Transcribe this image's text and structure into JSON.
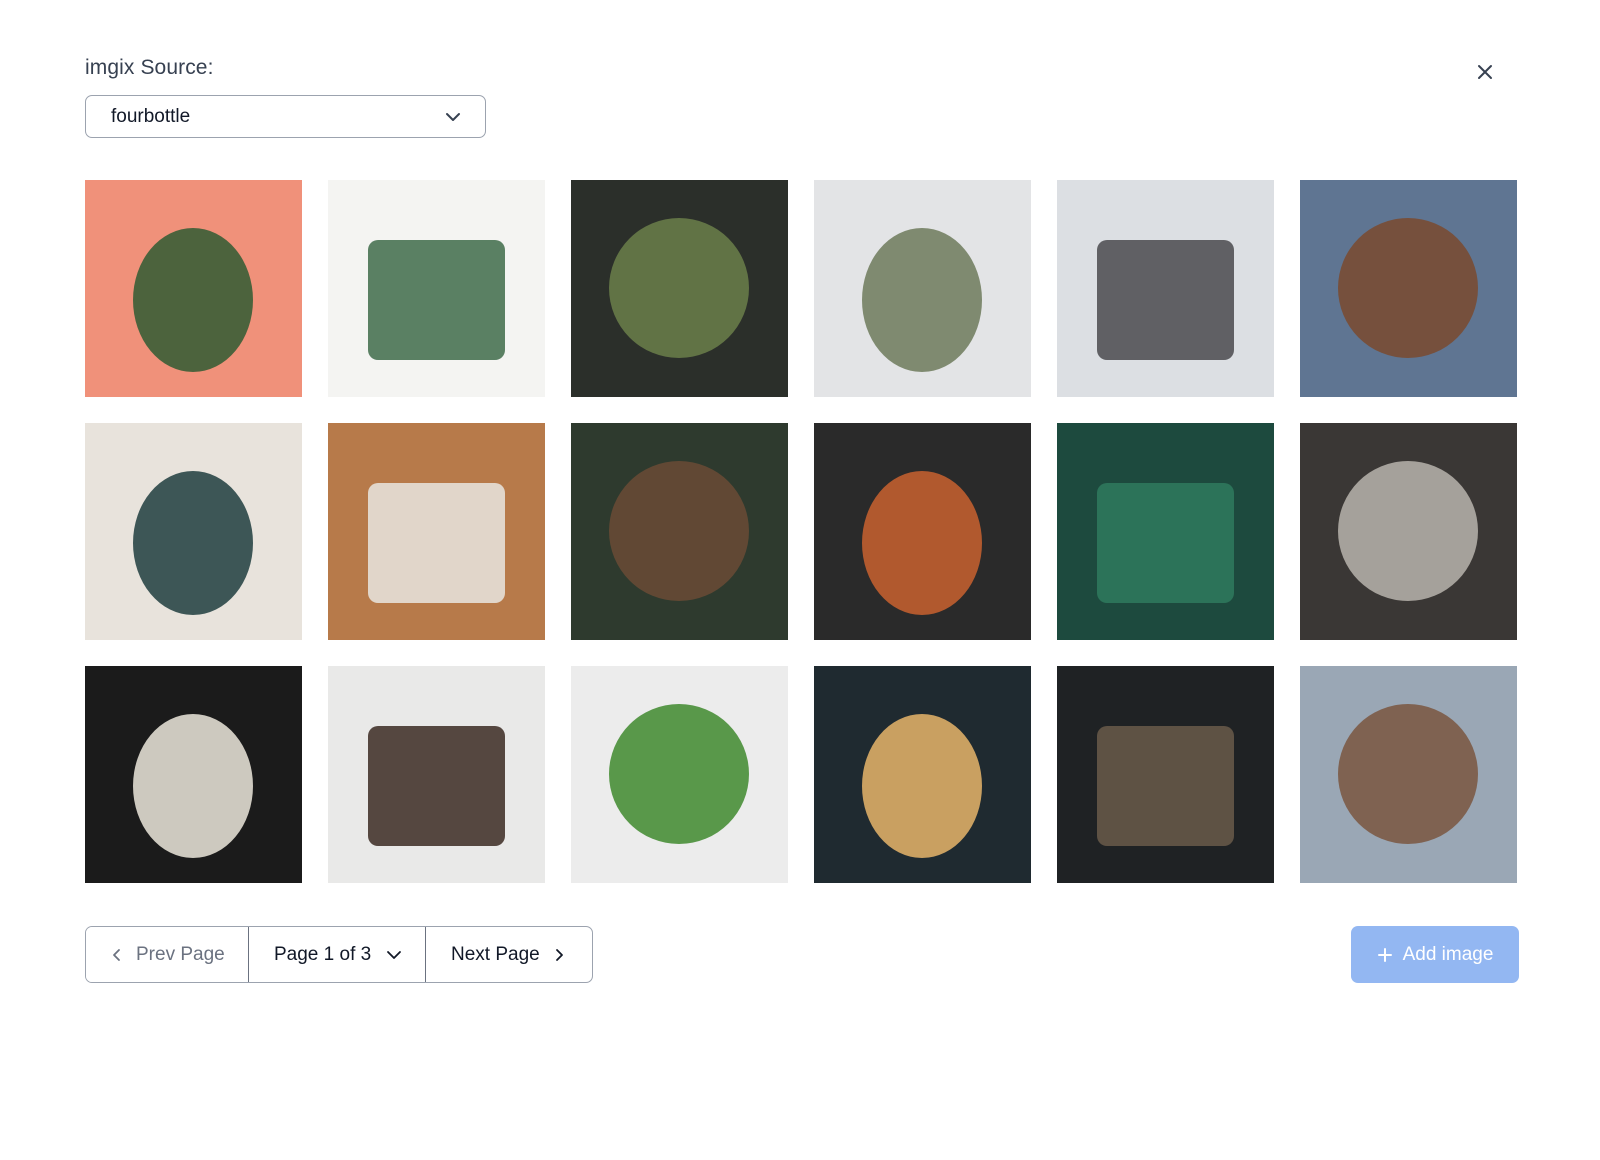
{
  "source": {
    "label": "imgix Source:",
    "selected": "fourbottle",
    "chevron_icon": "chevron-down-icon"
  },
  "close_icon": "close-icon",
  "images": [
    {
      "name": "image-pink-succulent",
      "bg": "#f0917a",
      "fg": "#2f5a32"
    },
    {
      "name": "image-aloe-pot",
      "bg": "#f4f4f2",
      "fg": "#3e6b4a"
    },
    {
      "name": "image-cafe-window-woman",
      "bg": "#2b2f2a",
      "fg": "#6b7f4a"
    },
    {
      "name": "image-plant-shelves",
      "bg": "#e3e4e6",
      "fg": "#6d7a5a"
    },
    {
      "name": "image-woman-coffee",
      "bg": "#dcdfe3",
      "fg": "#4a4a4e"
    },
    {
      "name": "image-pour-over",
      "bg": "#5f7592",
      "fg": "#7a4a2e"
    },
    {
      "name": "image-record-player",
      "bg": "#e8e3dc",
      "fg": "#1f3d3e"
    },
    {
      "name": "image-coffee-shelves",
      "bg": "#b77a4a",
      "fg": "#e9e6e1"
    },
    {
      "name": "image-clay-teapot",
      "bg": "#2e3a2e",
      "fg": "#6a4b35"
    },
    {
      "name": "image-office-cafe",
      "bg": "#2a2a2a",
      "fg": "#c9622f"
    },
    {
      "name": "image-striped-leaves",
      "bg": "#1d4a3e",
      "fg": "#2f7a5e"
    },
    {
      "name": "image-man-reading",
      "bg": "#3a3735",
      "fg": "#b9b4ad"
    },
    {
      "name": "image-chalk-menu",
      "bg": "#1b1b1b",
      "fg": "#ece8dc"
    },
    {
      "name": "image-glass-cup",
      "bg": "#e9e9e8",
      "fg": "#3b2a22"
    },
    {
      "name": "image-potted-plant",
      "bg": "#ececec",
      "fg": "#3f8a2e"
    },
    {
      "name": "image-pendant-lights",
      "bg": "#1f2a30",
      "fg": "#e8b56a"
    },
    {
      "name": "image-latte-table",
      "bg": "#1f2224",
      "fg": "#6a5a4a"
    },
    {
      "name": "image-man-mug",
      "bg": "#9aa7b5",
      "fg": "#7a5640"
    }
  ],
  "pager": {
    "prev_label": "Prev Page",
    "page_label": "Page 1 of 3",
    "next_label": "Next Page"
  },
  "add_button": {
    "label": "Add image",
    "color": "#93b7f2"
  }
}
